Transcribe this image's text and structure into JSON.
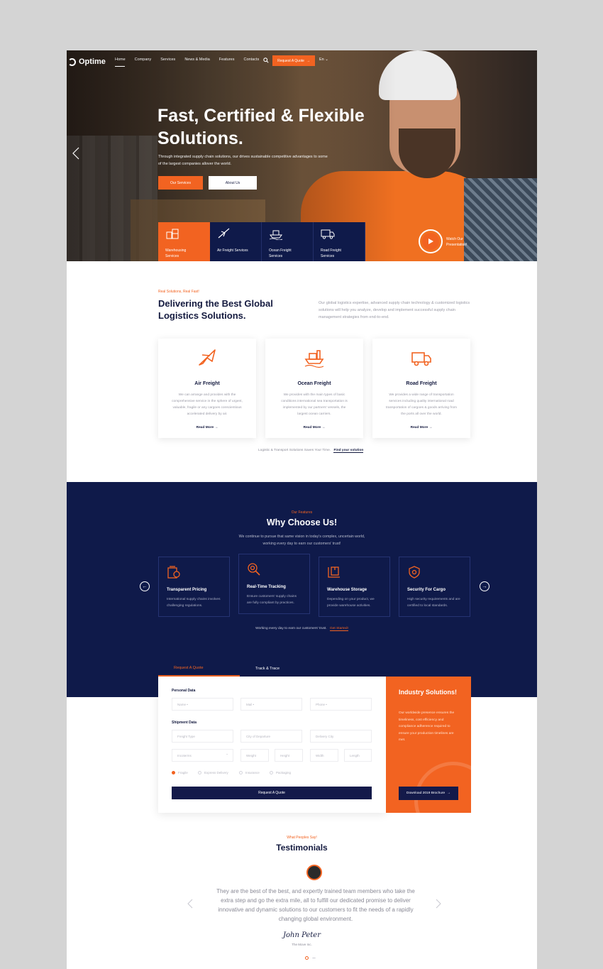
{
  "brand": {
    "name": "Optime",
    "accent": "#f26321",
    "navy": "#0f1a4a"
  },
  "nav": {
    "items": [
      "Home",
      "Company",
      "Services",
      "News & Media",
      "Features",
      "Contacts"
    ],
    "quote_button": "Request A Quote",
    "lang": "En"
  },
  "hero": {
    "title": "Fast, Certified & Flexible Solutions.",
    "subtitle": "Through integrated supply chain solutions, our drives sustainable competitive advantages to some of the largest companies allover the world.",
    "btn_services": "Our Services",
    "btn_about": "About Us",
    "tabs": [
      {
        "label": "Warehousing Services",
        "icon": "warehouse-icon"
      },
      {
        "label": "Air Freight Services",
        "icon": "plane-icon"
      },
      {
        "label": "Ocean Freight Services",
        "icon": "ship-icon"
      },
      {
        "label": "Road Freight Services",
        "icon": "truck-icon"
      }
    ],
    "watch_label": "Watch Our Presentation!"
  },
  "solutions": {
    "kicker": "Real Solutions, Real Fast!",
    "title": "Delivering the Best Global Logistics Solutions.",
    "description": "Our global logistics expertise, advanced supply chain technology & customized logistics solutions will help you analyze, develop and implement successful supply chain management strategies from end-to-end.",
    "cards": [
      {
        "title": "Air Freight",
        "text": "We can arrange and provides with the comprehensive service in the sphere of urgent, valuable, fragile or any cargoes conscientious accelerated delivery by air.",
        "link": "Read More →",
        "icon": "plane-icon"
      },
      {
        "title": "Ocean Freight",
        "text": "We provides with the main types of basic conditions international sea transportation is implemented by our partners' vessels, the largest ocean carriers.",
        "link": "Read More →",
        "icon": "ship-icon"
      },
      {
        "title": "Road Freight",
        "text": "We provides a wide range of transportation services including quality international road transportation of cargoes & goods arriving from the ports all over the world.",
        "link": "Read More →",
        "icon": "truck-icon"
      }
    ],
    "footer_text": "Logistic & Transport Solutions Saves Your Time.",
    "footer_link": "Find your solution"
  },
  "features": {
    "kicker": "Our Features",
    "title": "Why Choose Us!",
    "description": "We continue to pursue that same vision in today's complex, uncertain world, working every day to earn our customers' trust!",
    "items": [
      {
        "title": "Transparent Pricing",
        "text": "International supply chains involves challenging regulations.",
        "icon": "pricing-icon"
      },
      {
        "title": "Real-Time Tracking",
        "text": "Ensure customers' supply chains are fully compliant by practices.",
        "icon": "tracking-icon"
      },
      {
        "title": "Warehouse Storage",
        "text": "Depending on your product, we provide warehouse activities.",
        "icon": "storage-icon"
      },
      {
        "title": "Security For Cargo",
        "text": "High security requirements and are certified to local standards.",
        "icon": "security-icon"
      }
    ],
    "footer_text": "Working every day to earn our customers' trust.",
    "footer_link": "Get Started!"
  },
  "form": {
    "tabs": [
      "Request A Quote",
      "Track & Trace"
    ],
    "personal_label": "Personal Data",
    "shipment_label": "Shipment Data",
    "placeholders": {
      "name": "Name •",
      "mail": "Mail •",
      "phone": "Phone •",
      "freight": "Freight Type",
      "departure": "City of Departure",
      "delivery": "Delivery City",
      "incoterms": "Incoterms",
      "weight": "Weight",
      "height": "Height",
      "width": "Width",
      "length": "Length"
    },
    "checks": [
      "Fragile",
      "Express Delivery",
      "Insurance",
      "Packaging"
    ],
    "submit": "Request A Quote"
  },
  "industry": {
    "title": "Industry Solutions!",
    "text": "Our worldwide presence ensures the timeliness, cost efficiency and compliance adherence required to ensure your production timelines are met.",
    "button": "Download 2019 Brochure"
  },
  "testimonials": {
    "kicker": "What Peoples Say!",
    "title": "Testimonials",
    "quote": "They are the best of the best, and expertly trained team members who take the extra step and go the extra mile, all to fulfill our dedicated promise to deliver innovative and dynamic solutions to our customers to fit the needs of a rapidly changing global environment.",
    "signature": "John Peter",
    "company": "The Move Inc."
  }
}
